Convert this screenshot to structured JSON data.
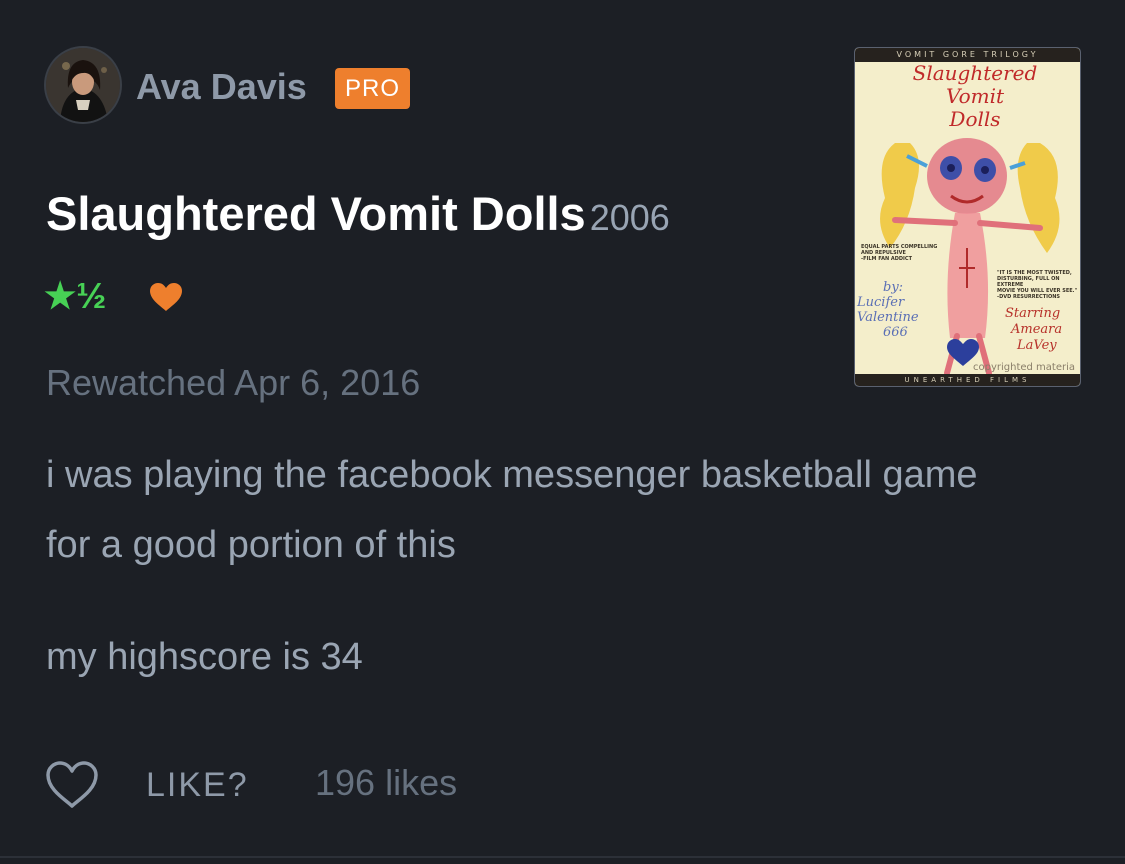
{
  "user": {
    "name": "Ava Davis",
    "badge": "PRO"
  },
  "film": {
    "title": "Slaughtered Vomit Dolls",
    "year": "2006"
  },
  "rating": {
    "stars": "★½",
    "value": 1.5,
    "liked": true,
    "star_color": "#47d155",
    "heart_color": "#ee7f2d"
  },
  "entry": {
    "watch_status": "Rewatched Apr 6, 2016"
  },
  "review": {
    "paragraphs": [
      "i was playing the facebook messenger basketball game for a good portion of this",
      "my highscore is 34"
    ]
  },
  "actions": {
    "like_label": "LIKE?",
    "likes_count": "196 likes"
  },
  "poster": {
    "series": "VOMIT GORE TRILOGY",
    "title_lines": [
      "Slaughtered",
      "Vomit",
      "Dolls"
    ],
    "credit_by": "by:",
    "credit_name_1": "Lucifer",
    "credit_name_2": "Valentine",
    "credit_name_3": "666",
    "starring_1": "Starring",
    "starring_2": "Ameara",
    "starring_3": "LaVey",
    "quote_left_1": "EQUAL PARTS COMPELLING",
    "quote_left_2": "AND REPULSIVE",
    "quote_left_3": "-FILM FAN ADDICT",
    "quote_right_1": "\"IT IS THE MOST TWISTED,",
    "quote_right_2": "DISTURBING, FULL ON EXTREME",
    "quote_right_3": "MOVIE YOU WILL EVER SEE.\"",
    "quote_right_4": "-DVD RESURRECTIONS",
    "watermark": "copyrighted materia",
    "studio": "UNEARTHED FILMS"
  },
  "colors": {
    "background": "#1c1f25",
    "accent_orange": "#ee7f2d",
    "accent_green": "#47d155"
  },
  "icons": {
    "like": "heart-outline-icon",
    "liked": "heart-filled-icon"
  }
}
